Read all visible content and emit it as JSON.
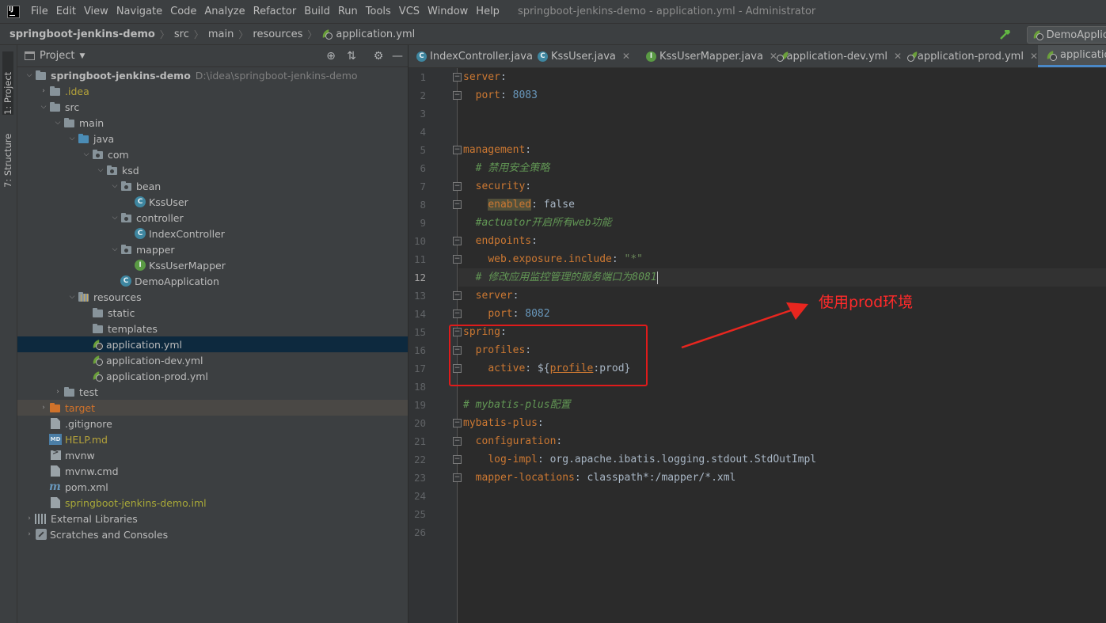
{
  "menubar": {
    "items": [
      "File",
      "Edit",
      "View",
      "Navigate",
      "Code",
      "Analyze",
      "Refactor",
      "Build",
      "Run",
      "Tools",
      "VCS",
      "Window",
      "Help"
    ],
    "window_title": "springboot-jenkins-demo - application.yml - Administrator"
  },
  "navbar": {
    "breadcrumbs": [
      "springboot-jenkins-demo",
      "src",
      "main",
      "resources",
      "application.yml"
    ],
    "run_config": "DemoApplica"
  },
  "toolstrip": {
    "project_tab": "1: Project",
    "structure_tab": "7: Structure"
  },
  "project": {
    "title": "Project",
    "root_path": "D:\\idea\\springboot-jenkins-demo",
    "tree": [
      {
        "label": "springboot-jenkins-demo",
        "depth": 0,
        "icon": "folder-icon",
        "expanded": true
      },
      {
        "label": ".idea",
        "depth": 1,
        "icon": "folder-icon",
        "expanded": false
      },
      {
        "label": "src",
        "depth": 1,
        "icon": "folder-icon",
        "expanded": true
      },
      {
        "label": "main",
        "depth": 2,
        "icon": "folder-icon",
        "expanded": true
      },
      {
        "label": "java",
        "depth": 3,
        "icon": "source-folder-icon",
        "expanded": true
      },
      {
        "label": "com",
        "depth": 4,
        "icon": "package-icon",
        "expanded": true
      },
      {
        "label": "ksd",
        "depth": 5,
        "icon": "package-icon",
        "expanded": true
      },
      {
        "label": "bean",
        "depth": 6,
        "icon": "package-icon",
        "expanded": true
      },
      {
        "label": "KssUser",
        "depth": 7,
        "icon": "class-icon"
      },
      {
        "label": "controller",
        "depth": 6,
        "icon": "package-icon",
        "expanded": true
      },
      {
        "label": "IndexController",
        "depth": 7,
        "icon": "class-icon"
      },
      {
        "label": "mapper",
        "depth": 6,
        "icon": "package-icon",
        "expanded": true
      },
      {
        "label": "KssUserMapper",
        "depth": 7,
        "icon": "interface-icon"
      },
      {
        "label": "DemoApplication",
        "depth": 6,
        "icon": "spring-class-icon"
      },
      {
        "label": "resources",
        "depth": 3,
        "icon": "resources-folder-icon",
        "expanded": true
      },
      {
        "label": "static",
        "depth": 4,
        "icon": "folder-icon"
      },
      {
        "label": "templates",
        "depth": 4,
        "icon": "folder-icon"
      },
      {
        "label": "application.yml",
        "depth": 4,
        "icon": "yaml-icon"
      },
      {
        "label": "application-dev.yml",
        "depth": 4,
        "icon": "yaml-icon"
      },
      {
        "label": "application-prod.yml",
        "depth": 4,
        "icon": "yaml-icon"
      },
      {
        "label": "test",
        "depth": 2,
        "icon": "folder-icon",
        "expanded": false
      },
      {
        "label": "target",
        "depth": 1,
        "icon": "excluded-folder-icon",
        "expanded": false
      },
      {
        "label": ".gitignore",
        "depth": 1,
        "icon": "text-file-icon"
      },
      {
        "label": "HELP.md",
        "depth": 1,
        "icon": "markdown-icon"
      },
      {
        "label": "mvnw",
        "depth": 1,
        "icon": "terminal-file-icon"
      },
      {
        "label": "mvnw.cmd",
        "depth": 1,
        "icon": "text-file-icon"
      },
      {
        "label": "pom.xml",
        "depth": 1,
        "icon": "maven-icon"
      },
      {
        "label": "springboot-jenkins-demo.iml",
        "depth": 1,
        "icon": "module-file-icon"
      },
      {
        "label": "External Libraries",
        "depth": 0,
        "icon": "libraries-icon",
        "expanded": false
      },
      {
        "label": "Scratches and Consoles",
        "depth": 0,
        "icon": "scratches-icon",
        "expanded": false
      }
    ]
  },
  "editor": {
    "tabs": [
      {
        "label": "IndexController.java",
        "icon": "class-icon"
      },
      {
        "label": "KssUser.java",
        "icon": "class-icon"
      },
      {
        "label": "KssUserMapper.java",
        "icon": "interface-icon"
      },
      {
        "label": "application-dev.yml",
        "icon": "yaml-icon"
      },
      {
        "label": "application-prod.yml",
        "icon": "yaml-icon"
      },
      {
        "label": "application",
        "icon": "yaml-icon",
        "active": true
      }
    ],
    "current_line": 12,
    "lines": [
      "server:",
      "  port: 8083",
      "",
      "",
      "management:",
      "  # 禁用安全策略",
      "  security:",
      "    enabled: false",
      "  #actuator开启所有web功能",
      "  endpoints:",
      "    web.exposure.include: \"*\"",
      "  # 修改应用监控管理的服务端口为8081",
      "  server:",
      "    port: 8082",
      "spring:",
      "  profiles:",
      "    active: ${profile:prod}",
      "",
      "# mybatis-plus配置",
      "mybatis-plus:",
      "  configuration:",
      "    log-impl: org.apache.ibatis.logging.stdout.StdOutImpl",
      "  mapper-locations: classpath*:/mapper/*.xml",
      "",
      "",
      ""
    ]
  },
  "annotation": {
    "text": "使用prod环境",
    "color": "#ff2a2a"
  }
}
